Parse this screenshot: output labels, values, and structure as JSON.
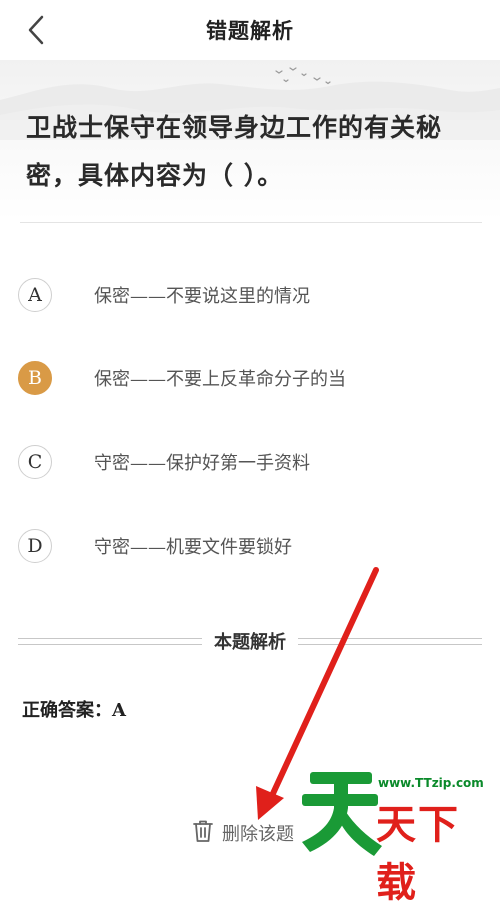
{
  "header": {
    "title": "错题解析"
  },
  "question": {
    "text": "卫战士保守在领导身边工作的有关秘密，具体内容为（    ）。"
  },
  "options": [
    {
      "letter": "A",
      "text": "保密——不要说这里的情况",
      "state": "normal"
    },
    {
      "letter": "B",
      "text": "保密——不要上反革命分子的当",
      "state": "selected-wrong"
    },
    {
      "letter": "C",
      "text": "守密——保护好第一手资料",
      "state": "normal"
    },
    {
      "letter": "D",
      "text": "守密——机要文件要锁好",
      "state": "normal"
    }
  ],
  "analysis": {
    "section_title": "本题解析",
    "correct_answer": "正确答案：A"
  },
  "actions": {
    "delete_label": "删除该题"
  },
  "watermark": {
    "url": "www.TTzip.com",
    "text": "天下载"
  },
  "colors": {
    "wrong_option": "#d99a46",
    "annotation_arrow": "#e0201b",
    "watermark_green": "#0a8a2a"
  }
}
